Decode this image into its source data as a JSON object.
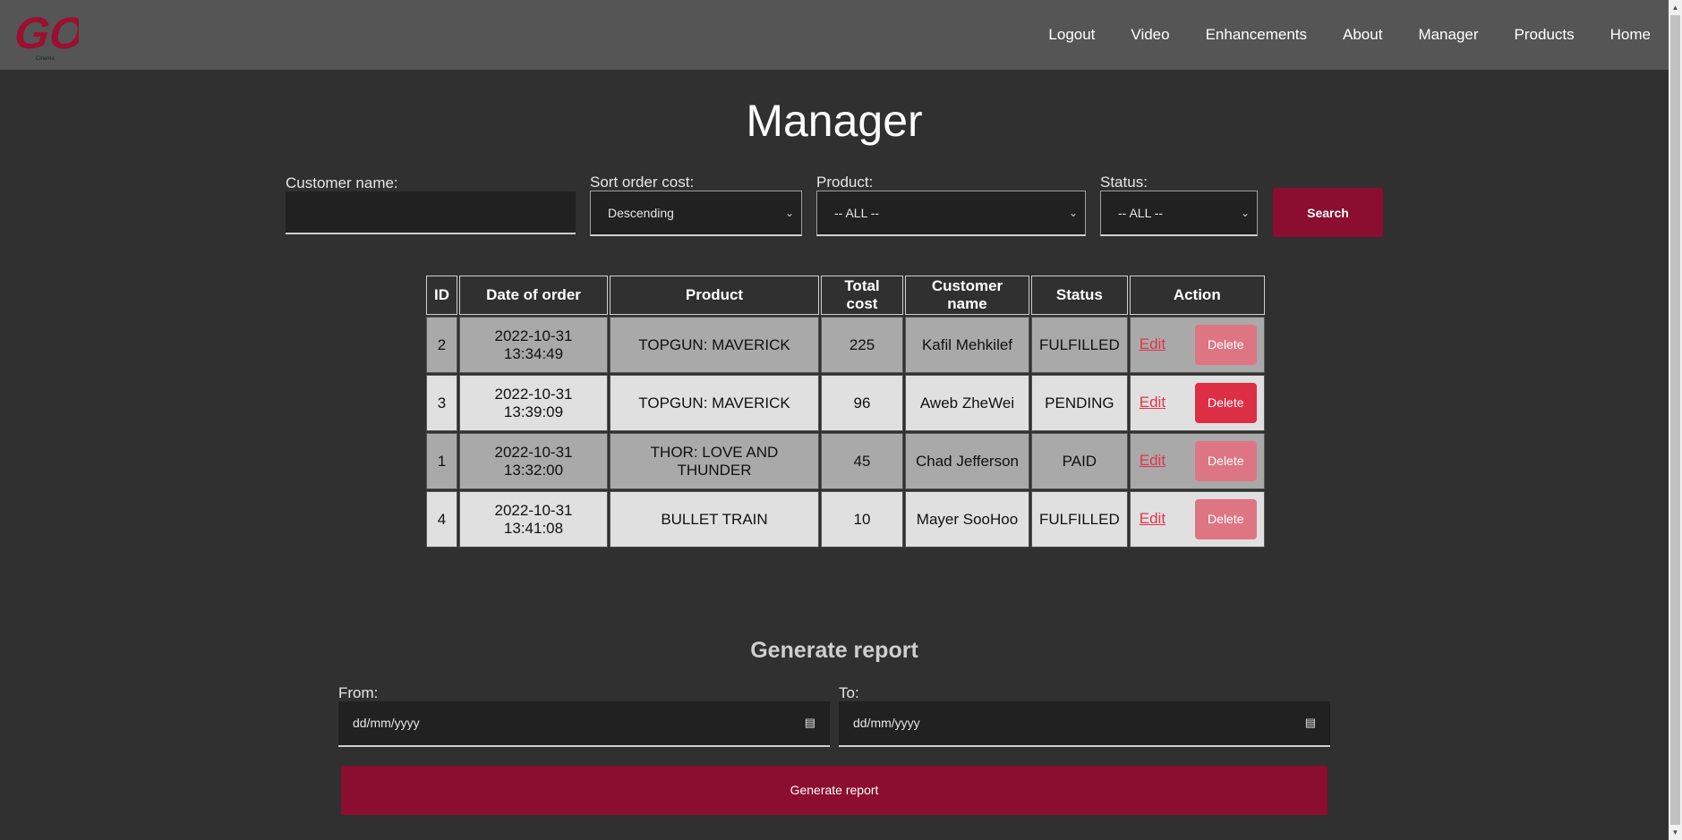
{
  "nav": {
    "logo_text": "GOI",
    "links": [
      "Home",
      "Products",
      "Manager",
      "About",
      "Enhancements",
      "Video",
      "Logout"
    ]
  },
  "page": {
    "title": "Manager"
  },
  "filters": {
    "customer_label": "Customer name:",
    "customer_value": "",
    "sort_label": "Sort order cost:",
    "sort_value": "Descending",
    "product_label": "Product:",
    "product_value": "-- ALL --",
    "status_label": "Status:",
    "status_value": "-- ALL --",
    "search_label": "Search"
  },
  "table": {
    "headers": [
      "ID",
      "Date of order",
      "Product",
      "Total cost",
      "Customer name",
      "Status",
      "Action"
    ],
    "rows": [
      {
        "id": "2",
        "date": "2022-10-31 13:34:49",
        "product": "TOPGUN: MAVERICK",
        "cost": "225",
        "customer": "Kafil Mehkilef",
        "status": "FULFILLED",
        "edit": "Edit",
        "delete": "Delete"
      },
      {
        "id": "3",
        "date": "2022-10-31 13:39:09",
        "product": "TOPGUN: MAVERICK",
        "cost": "96",
        "customer": "Aweb ZheWei",
        "status": "PENDING",
        "edit": "Edit",
        "delete": "Delete"
      },
      {
        "id": "1",
        "date": "2022-10-31 13:32:00",
        "product": "THOR: LOVE AND THUNDER",
        "cost": "45",
        "customer": "Chad Jefferson",
        "status": "PAID",
        "edit": "Edit",
        "delete": "Delete"
      },
      {
        "id": "4",
        "date": "2022-10-31 13:41:08",
        "product": "BULLET TRAIN",
        "cost": "10",
        "customer": "Mayer SooHoo",
        "status": "FULFILLED",
        "edit": "Edit",
        "delete": "Delete"
      }
    ]
  },
  "report": {
    "title": "Generate report",
    "from_label": "From:",
    "from_value": "dd/mm/yyyy",
    "to_label": "To:",
    "to_value": "dd/mm/yyyy",
    "button_label": "Generate report"
  },
  "colors": {
    "accent": "#8b0d2f",
    "delete_active": "#dc2f45",
    "delete_faded": "#dd7682",
    "navbar": "#555555",
    "background": "#303030"
  }
}
